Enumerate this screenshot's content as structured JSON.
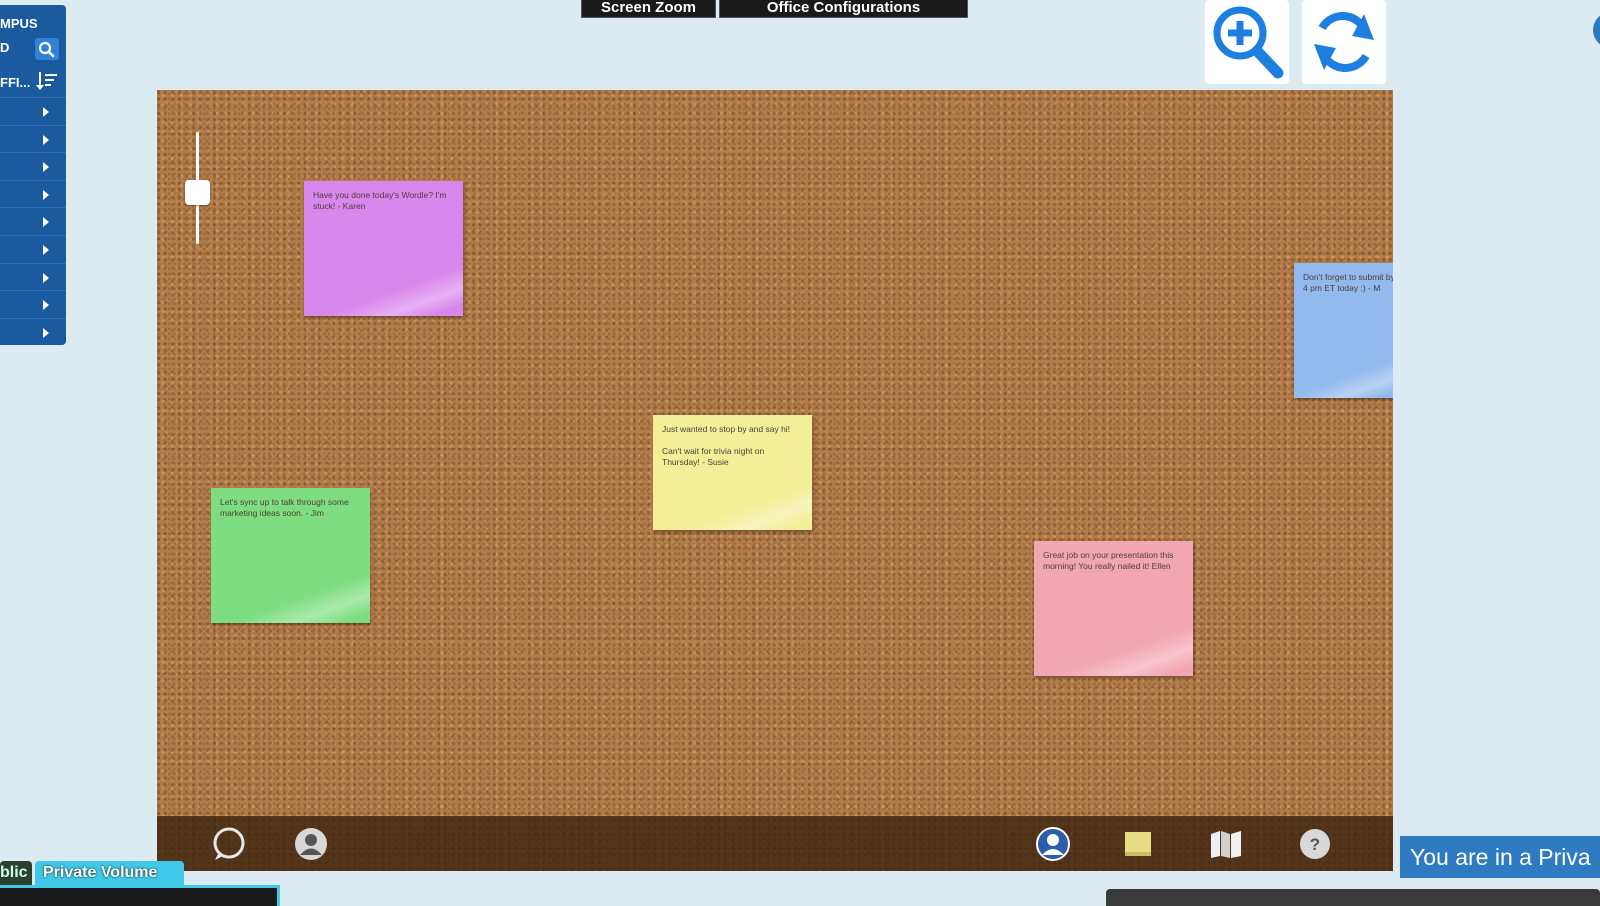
{
  "top_tabs": {
    "screen_zoom": "Screen Zoom",
    "office_configurations": "Office Configurations"
  },
  "sidebar": {
    "line1": "MPUS",
    "line2": "D",
    "line3": "FFI...",
    "row_count": 9
  },
  "notes": [
    {
      "color": "#d887ec",
      "text": "Have you done today's Wordle? I'm stuck! - Karen"
    },
    {
      "color": "#f3ef98",
      "text": "Just wanted to stop by and say hi!\n\nCan't wait for trivia night on Thursday! - Susie"
    },
    {
      "color": "#7ede7f",
      "text": "Let's sync up to talk through some marketing ideas soon. - Jim"
    },
    {
      "color": "#f2a6b3",
      "text": "Great job on your presentation this morning! You really nailed it! Ellen"
    },
    {
      "color": "#93baee",
      "text": "Don't forget to submit by 4 pm ET today :) - M"
    }
  ],
  "volume_tabs": {
    "public": "blic",
    "private": "Private Volume"
  },
  "banner": {
    "text": "You are in a Priva"
  },
  "colors": {
    "sidebar": "#1c5aa0",
    "accent": "#2f7bc3",
    "cork": "#b27c4a"
  }
}
